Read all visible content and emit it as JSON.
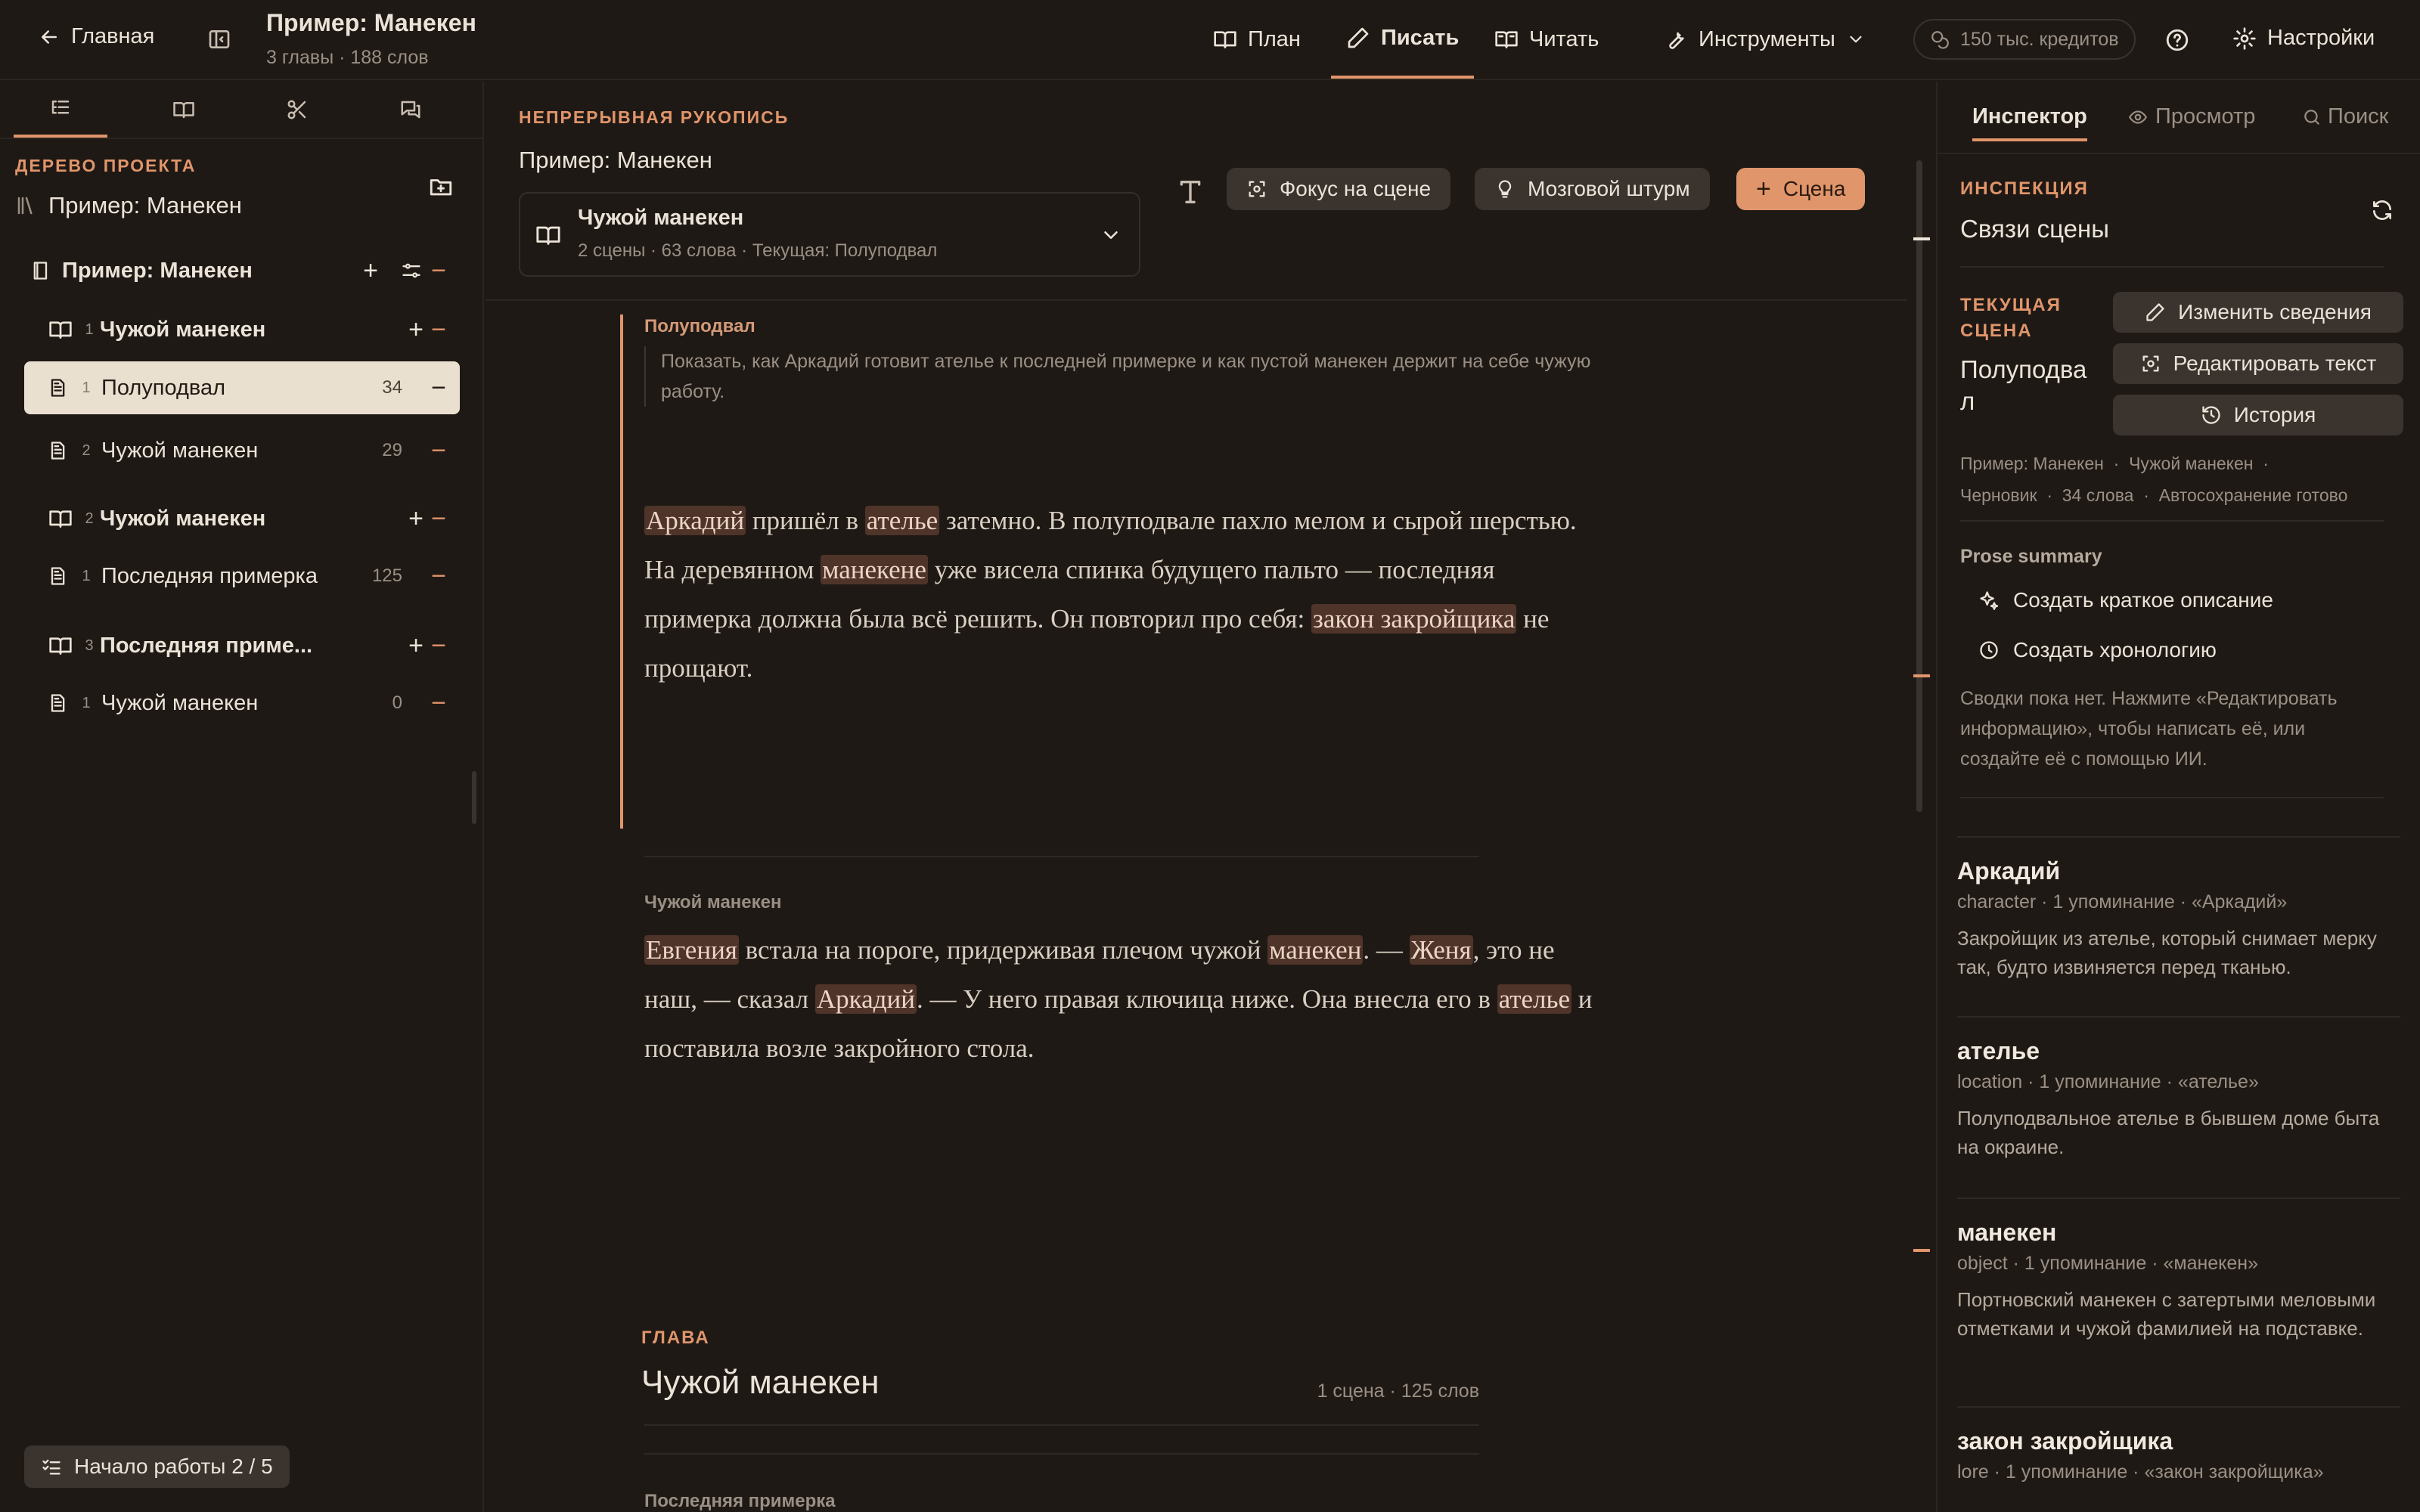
{
  "topbar": {
    "home_label": "Главная",
    "project_title": "Пример: Манекен",
    "project_meta": "3 главы · 188 слов",
    "nav": [
      {
        "label": "План"
      },
      {
        "label": "Писать"
      },
      {
        "label": "Читать"
      },
      {
        "label": "Инструменты"
      }
    ],
    "credits": "150 тыс. кредитов",
    "settings_label": "Настройки"
  },
  "left": {
    "tree_heading": "ДЕРЕВО ПРОЕКТА",
    "project_name": "Пример: Манекен",
    "book_title": "Пример: Манекен",
    "chapters": [
      {
        "num": "1",
        "title": "Чужой манекен",
        "scenes": [
          {
            "num": "1",
            "title": "Полуподвал",
            "count": "34"
          },
          {
            "num": "2",
            "title": "Чужой манекен",
            "count": "29"
          }
        ]
      },
      {
        "num": "2",
        "title": "Чужой манекен",
        "scenes": [
          {
            "num": "1",
            "title": "Последняя примерка",
            "count": "125"
          }
        ]
      },
      {
        "num": "3",
        "title": "Последняя приме...",
        "scenes": [
          {
            "num": "1",
            "title": "Чужой манекен",
            "count": "0"
          }
        ]
      }
    ],
    "onboarding": "Начало работы 2 / 5"
  },
  "center": {
    "section_label": "НЕПРЕРЫВНАЯ РУКОПИСЬ",
    "doc_title": "Пример: Манекен",
    "chapter_select": {
      "title": "Чужой манекен",
      "meta": "2 сцены · 63 слова · Текущая: Полуподвал"
    },
    "buttons": {
      "focus": "Фокус на сцене",
      "brainstorm": "Мозговой штурм",
      "scene": "Сцена"
    },
    "scene1": {
      "title": "Полуподвал",
      "synopsis": "Показать, как Аркадий готовит ателье к последней примерке и как пустой манекен держит на себе чужую работу."
    },
    "scene2": {
      "title": "Чужой манекен"
    },
    "chapter2": {
      "label": "ГЛАВА",
      "title": "Чужой манекен",
      "meta": "1 сцена · 125 слов"
    },
    "scene3": {
      "title": "Последняя примерка"
    }
  },
  "right": {
    "tabs": [
      {
        "label": "Инспектор"
      },
      {
        "label": "Просмотр"
      },
      {
        "label": "Поиск"
      }
    ],
    "inspect_label": "ИНСПЕКЦИЯ",
    "inspect_title": "Связи сцены",
    "current_label_1": "ТЕКУЩАЯ",
    "current_label_2": "СЦЕНА",
    "current_name_1": "Полуподва",
    "current_name_2": "л",
    "btn_edit_info": "Изменить сведения",
    "btn_edit_text": "Редактировать текст",
    "btn_history": "История",
    "meta_line_1": "Пример: Манекен  ·  Чужой манекен  ·",
    "meta_line_2": "Черновик  ·  34 слова  ·  Автосохранение готово",
    "prose_summary": "Prose summary",
    "create_summary": "Создать краткое описание",
    "create_timeline": "Создать хронологию",
    "summary_hint": "Сводки пока нет. Нажмите «Редактировать информацию», чтобы написать её, или создайте её с помощью ИИ.",
    "entities": [
      {
        "name": "Аркадий",
        "meta": "character · 1 упоминание · «Аркадий»",
        "desc": "Закройщик из ателье, который снимает мерку так, будто извиняется перед тканью."
      },
      {
        "name": "ателье",
        "meta": "location · 1 упоминание · «ателье»",
        "desc": "Полуподвальное ателье в бывшем доме быта на окраине."
      },
      {
        "name": "манекен",
        "meta": "object · 1 упоминание · «манекен»",
        "desc": "Портновский манекен с затертыми меловыми отметками и чужой фамилией на подставке."
      },
      {
        "name": "закон закройщика",
        "meta": "lore · 1 упоминание · «закон закройщика»",
        "desc": ""
      }
    ]
  },
  "colors": {
    "accent": "#e0956a",
    "bg": "#1f1915",
    "highlight": "#4e3429",
    "selected_row": "#eae0cf"
  }
}
